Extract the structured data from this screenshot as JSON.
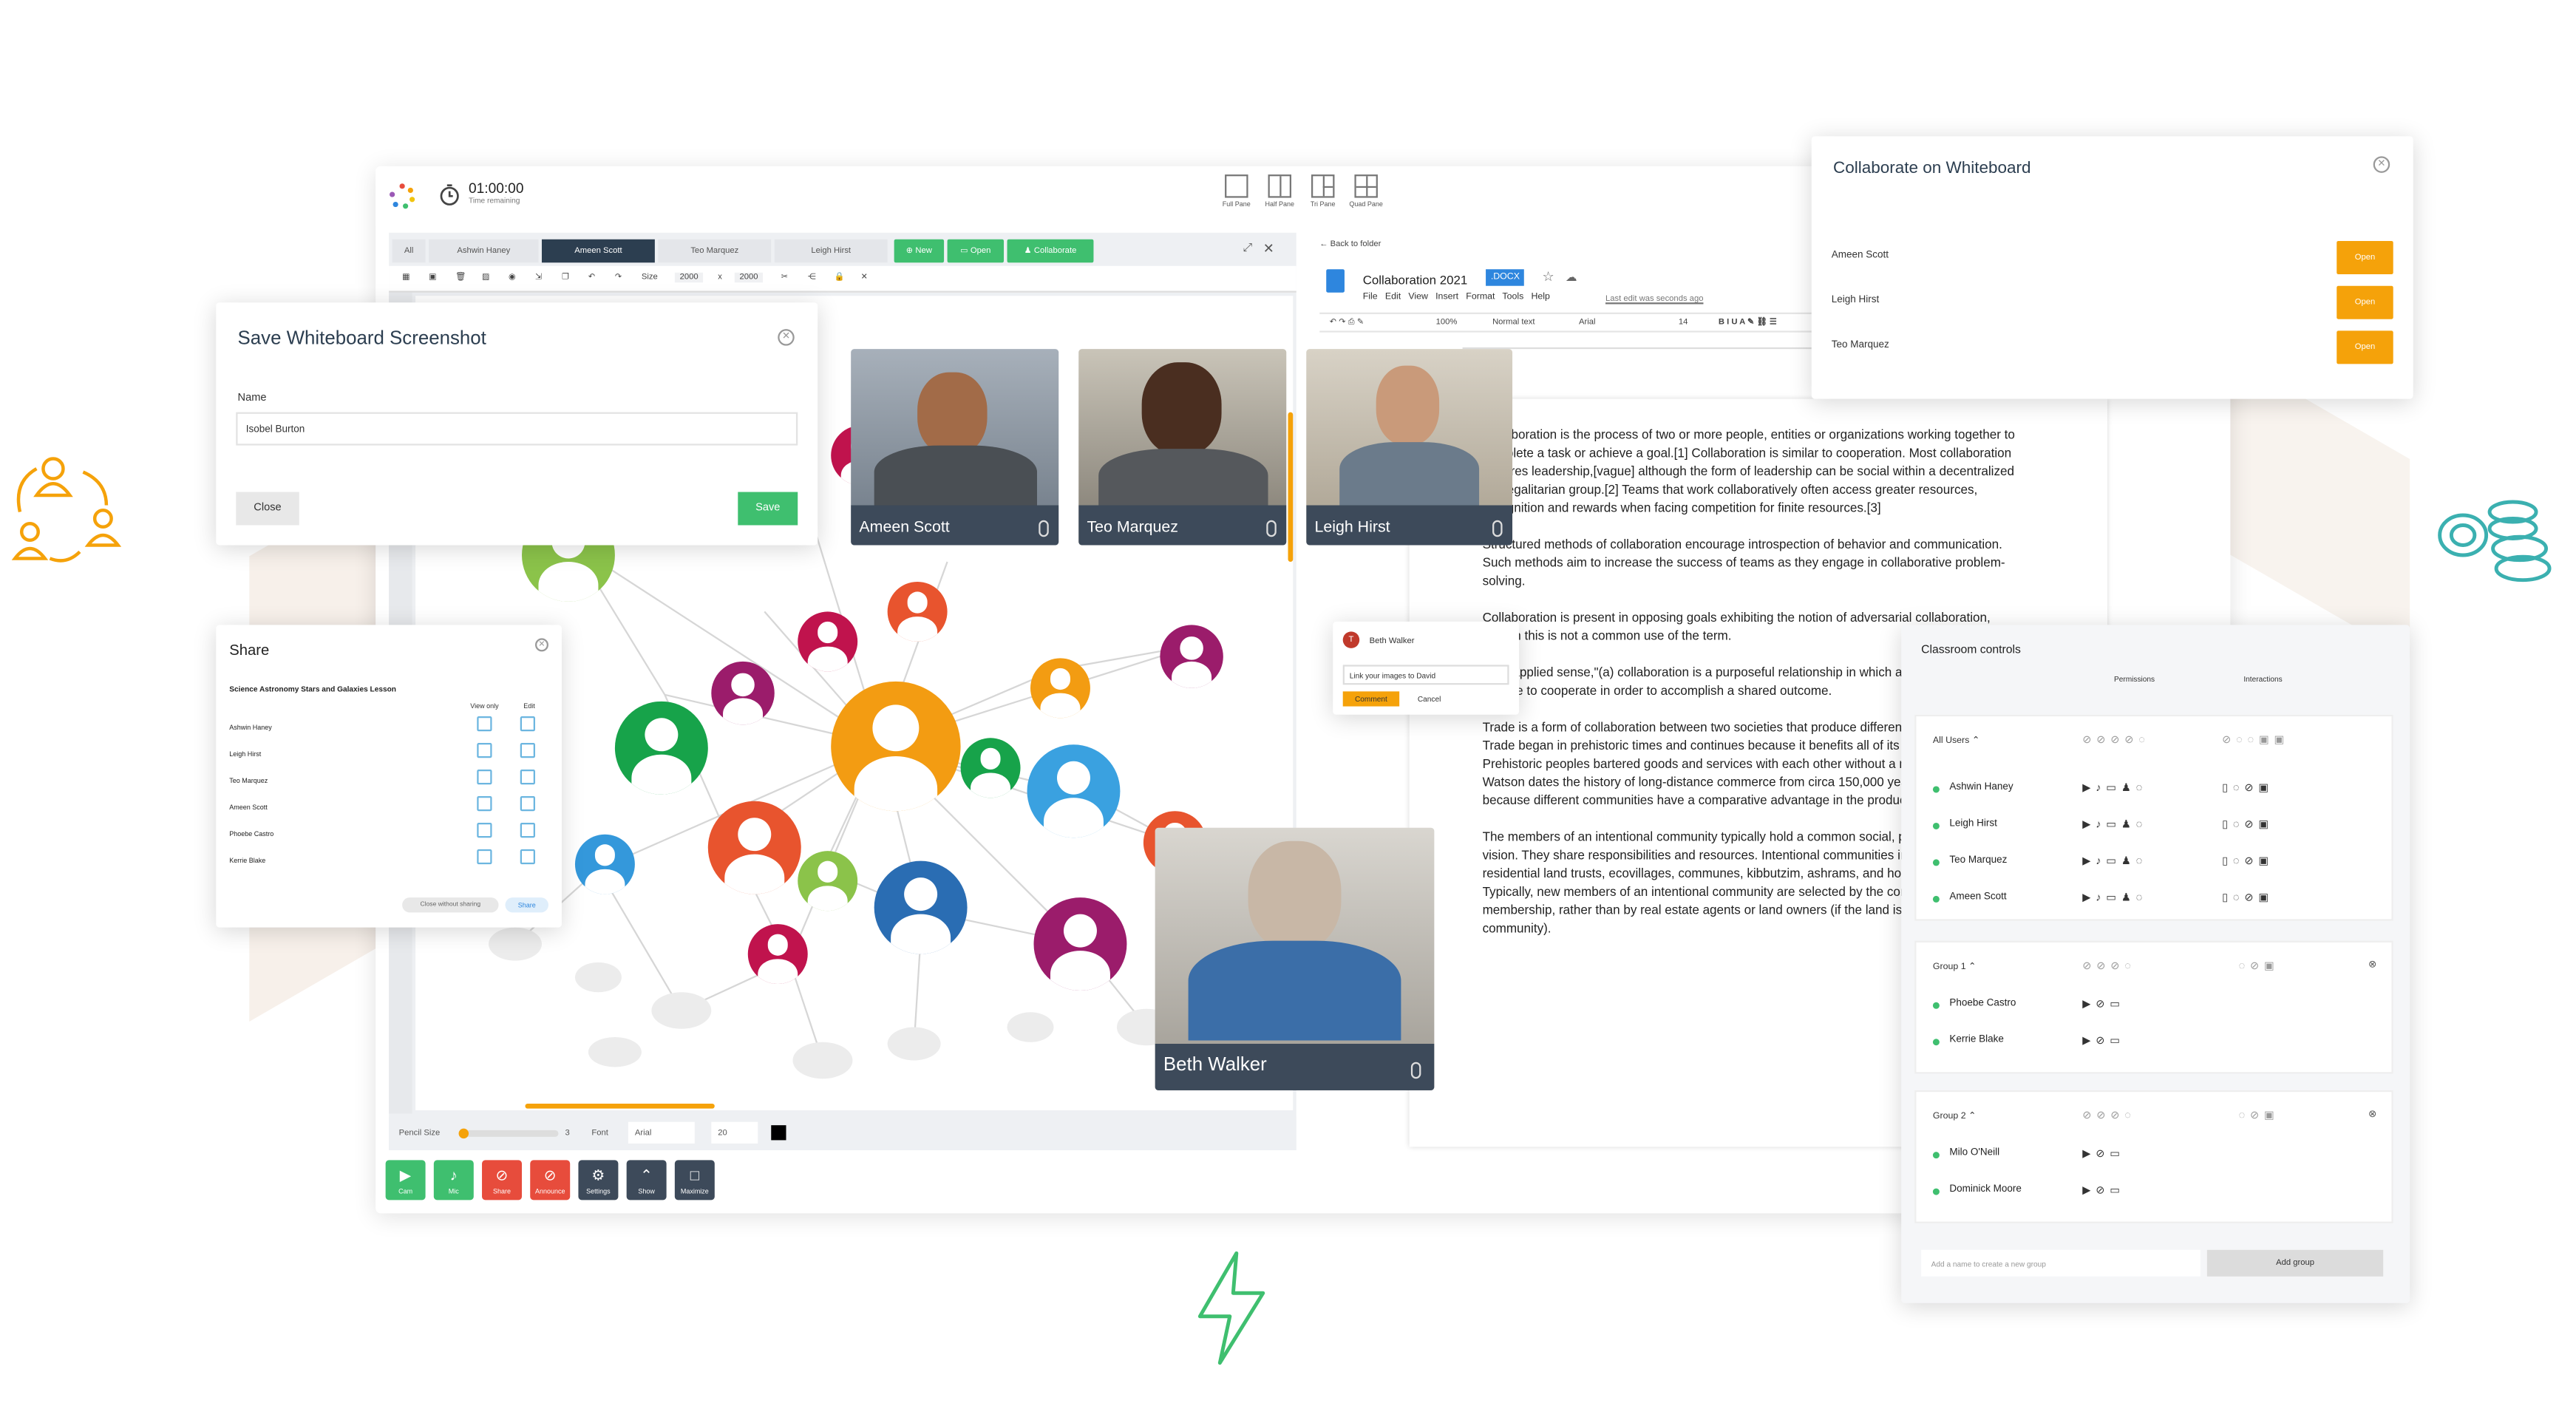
{
  "colors": {
    "accent_green": "#3fbf6f",
    "accent_orange": "#f5a20a",
    "dark": "#2c3e50",
    "red": "#e74c3c"
  },
  "timer": {
    "value": "01:00:00",
    "label": "Time remaining"
  },
  "layouts": [
    "Full Pane",
    "Half Pane",
    "Tri Pane",
    "Quad Pane"
  ],
  "wb_tabs": [
    "All",
    "Ashwin Haney",
    "Ameen Scott",
    "Teo Marquez",
    "Leigh Hirst"
  ],
  "wb_actions": [
    "New",
    "Open",
    "Collaborate"
  ],
  "wb_toolbar": {
    "size_label": "Size",
    "width": "2000",
    "x": "x",
    "height": "2000"
  },
  "wb_bottom": {
    "pencil_label": "Pencil Size",
    "pencil_value": "3",
    "font_label": "Font",
    "font_value": "Arial",
    "font_size": "20"
  },
  "controls": [
    "Cam",
    "Mic",
    "Share",
    "Announce",
    "Settings",
    "Show",
    "Maximize"
  ],
  "save_dialog": {
    "title": "Save Whiteboard Screenshot",
    "name_label": "Name",
    "name_value": "Isobel Burton",
    "close": "Close",
    "save": "Save"
  },
  "share_dialog": {
    "title": "Share",
    "lesson": "Science Astronomy Stars and Galaxies Lesson",
    "col_view": "View only",
    "col_edit": "Edit",
    "users": [
      "Ashwin Haney",
      "Leigh Hirst",
      "Teo Marquez",
      "Ameen Scott",
      "Phoebe Castro",
      "Kerrie Blake"
    ],
    "close_btn": "Close without sharing",
    "share_btn": "Share"
  },
  "videos": [
    {
      "name": "Ameen Scott"
    },
    {
      "name": "Teo Marquez"
    },
    {
      "name": "Leigh Hirst"
    },
    {
      "name": "Beth Walker"
    }
  ],
  "doc": {
    "back": "Back to folder",
    "title": "Collaboration 2021",
    "ext": ".DOCX",
    "menu": [
      "File",
      "Edit",
      "View",
      "Insert",
      "Format",
      "Tools",
      "Help"
    ],
    "last_edit": "Last edit was seconds ago",
    "zoom": "100%",
    "style": "Normal text",
    "font": "Arial",
    "font_size": "14",
    "paragraphs": [
      "Collaboration is the process of two or more people, entities or organizations working together to complete a task or achieve a goal.[1] Collaboration is similar to cooperation. Most collaboration requires leadership,[vague] although the form of leadership can be social within a decentralized and egalitarian group.[2] Teams that work collaboratively often access greater resources, recognition and rewards when facing competition for finite resources.[3]",
      "Structured methods of collaboration encourage introspection of behavior and communication. Such methods aim to increase the success of teams as they engage in collaborative problem-solving.",
      "Collaboration is present in opposing goals exhibiting the notion of adversarial collaboration, though this is not a common use of the term.",
      "In its applied sense,\"(a) collaboration is a purposeful relationship in which all parties strategically choose to cooperate in order to accomplish a shared outcome.",
      "Trade is a form of collaboration between two societies that produce different portfolios of goods. Trade began in prehistoric times and continues because it benefits all of its participants. Prehistoric peoples bartered goods and services with each other without a modern currency. Peter Watson dates the history of long-distance commerce from circa 150,000 years ago. Trade exists because different communities have a comparative advantage in the production of tradable goods.",
      "The members of an intentional community typically hold a common social, political or spiritual vision. They share responsibilities and resources. Intentional communities include cohousing, residential land trusts, ecovillages, communes, kibbutzim, ashrams, and housing cooperatives. Typically, new members of an intentional community are selected by the community's existing membership, rather than by real estate agents or land owners (if the land is not owned by the community)."
    ]
  },
  "comment": {
    "author": "Beth Walker",
    "initial": "T",
    "text": "Link your images to David",
    "comment_btn": "Comment",
    "cancel_btn": "Cancel"
  },
  "collab_panel": {
    "title": "Collaborate on Whiteboard",
    "users": [
      "Ameen Scott",
      "Leigh Hirst",
      "Teo Marquez"
    ],
    "open": "Open"
  },
  "classroom": {
    "title": "Classroom controls",
    "permissions": "Permissions",
    "interactions": "Interactions",
    "all_users": "All Users",
    "users": [
      "Ashwin Haney",
      "Leigh Hirst",
      "Teo Marquez",
      "Ameen Scott"
    ],
    "group1": "Group 1",
    "group1_users": [
      "Phoebe Castro",
      "Kerrie Blake"
    ],
    "group2": "Group 2",
    "group2_users": [
      "Milo O'Neill",
      "Dominick Moore"
    ],
    "add_placeholder": "Add a name to create a new group",
    "add_btn": "Add group"
  }
}
